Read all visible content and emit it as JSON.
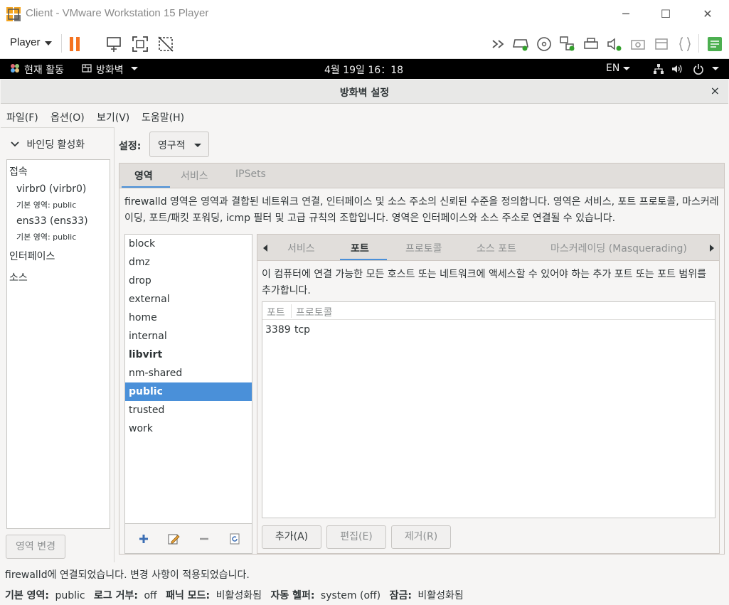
{
  "window": {
    "title": "Client - VMware Workstation 15 Player",
    "minimize": "─",
    "maximize": "☐",
    "close": "✕"
  },
  "vm_toolbar": {
    "player_label": "Player",
    "pause_icon": "pause-icon",
    "send_keys_icon": "ctrl-alt-del-icon",
    "fullscreen_icon": "fullscreen-icon",
    "unity_icon": "unity-icon",
    "right_icons": [
      "double-chevron-icon",
      "hdd-icon",
      "cd-icon",
      "network-icon",
      "printer-icon",
      "sound-icon",
      "camera-icon",
      "usb-icon",
      "bracket-icon",
      "notes-icon"
    ]
  },
  "gnome_bar": {
    "activities": "현재 활동",
    "app_menu": "방화벽",
    "clock": "4월 19일 16：18",
    "language": "EN"
  },
  "dialog": {
    "title": "방화벽 설정",
    "close": "×"
  },
  "menu": {
    "file": "파일(F)",
    "options": "옵션(O)",
    "view": "보기(V)",
    "help": "도움말(H)"
  },
  "left": {
    "binding_toggle": "바인딩 활성화",
    "connections_header": "접속",
    "connections": [
      {
        "name": "virbr0 (virbr0)",
        "zone": "기본 영역: public"
      },
      {
        "name": "ens33 (ens33)",
        "zone": "기본 영역: public"
      }
    ],
    "interfaces_header": "인터페이스",
    "sources_header": "소스",
    "change_zone_button": "영역 변경"
  },
  "config": {
    "label": "설정:",
    "value": "영구적"
  },
  "top_tabs": [
    "영역",
    "서비스",
    "IPSets"
  ],
  "zone_description": "firewalld 영역은 영역과 결합된 네트워크 연결, 인터페이스 및 소스 주소의 신뢰된 수준을 정의합니다. 영역은 서비스, 포트 프로토콜, 마스커레이딩, 포트/패킷 포워딩, icmp 필터 및 고급 규칙의 조합입니다. 영역은 인터페이스와 소스 주소로 연결될 수 있습니다.",
  "zones": [
    "block",
    "dmz",
    "drop",
    "external",
    "home",
    "internal",
    "libvirt",
    "nm-shared",
    "public",
    "trusted",
    "work"
  ],
  "selected_zone": "public",
  "sub_tabs": [
    "서비스",
    "포트",
    "프로토콜",
    "소스 포트",
    "마스커레이딩 (Masquerading)"
  ],
  "port_description": "이 컴퓨터에 연결 가능한 모든 호스트 또는 네트워크에 액세스할 수 있어야 하는 추가 포트 또는 포트 범위를 추가합니다.",
  "port_table": {
    "columns": [
      "포트",
      "프로토콜"
    ],
    "rows": [
      {
        "port": "3389",
        "protocol": "tcp"
      }
    ]
  },
  "port_buttons": {
    "add": "추가(A)",
    "edit": "편집(E)",
    "remove": "제거(R)"
  },
  "status": {
    "message": "firewalld에 연결되었습니다. 변경 사항이 적용되었습니다.",
    "default_zone_label": "기본 영역:",
    "default_zone": "public",
    "log_denied_label": "로그 거부:",
    "log_denied": "off",
    "panic_label": "패닉 모드:",
    "panic": "비활성화됨",
    "helper_label": "자동 헬퍼:",
    "helper": "system (off)",
    "lockdown_label": "잠금:",
    "lockdown": "비활성화됨"
  },
  "colors": {
    "accent": "#4a90d9",
    "pause": "#f47321"
  }
}
